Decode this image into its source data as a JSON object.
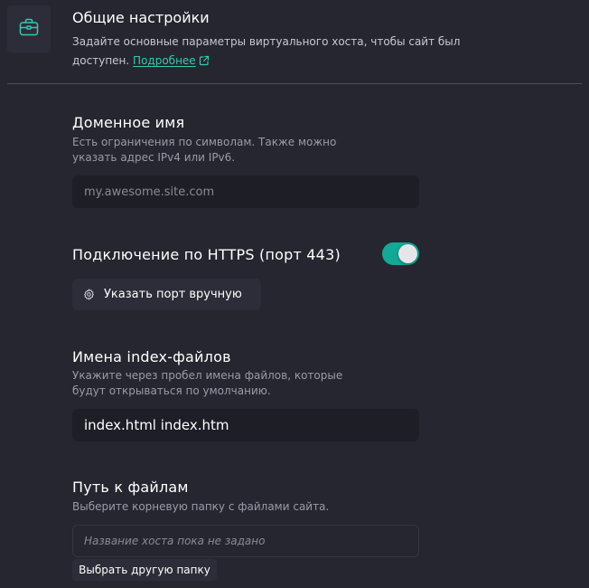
{
  "header": {
    "icon": "briefcase-icon",
    "title": "Общие настройки",
    "description": "Задайте основные параметры виртуального хоста, чтобы сайт был доступен.",
    "link_label": "Подробнее"
  },
  "domain": {
    "title": "Доменное имя",
    "description": "Есть ограничения по символам. Также можно указать адрес IPv4 или IPv6.",
    "placeholder": "my.awesome.site.com",
    "value": ""
  },
  "https": {
    "title": "Подключение по HTTPS (порт 443)",
    "enabled": true,
    "port_button_label": "Указать порт вручную"
  },
  "index_files": {
    "title": "Имена index-файлов",
    "description": "Укажите через пробел имена файлов, которые будут открываться по умолчанию.",
    "value": "index.html index.htm"
  },
  "file_path": {
    "title": "Путь к файлам",
    "description": "Выберите корневую папку с файлами сайта.",
    "placeholder": "Название хоста пока не задано",
    "button_label": "Выбрать другую папку"
  },
  "colors": {
    "background": "#262630",
    "accent": "#35c9b1",
    "toggle_on": "#14a896",
    "input_bg": "#1e1e27"
  }
}
